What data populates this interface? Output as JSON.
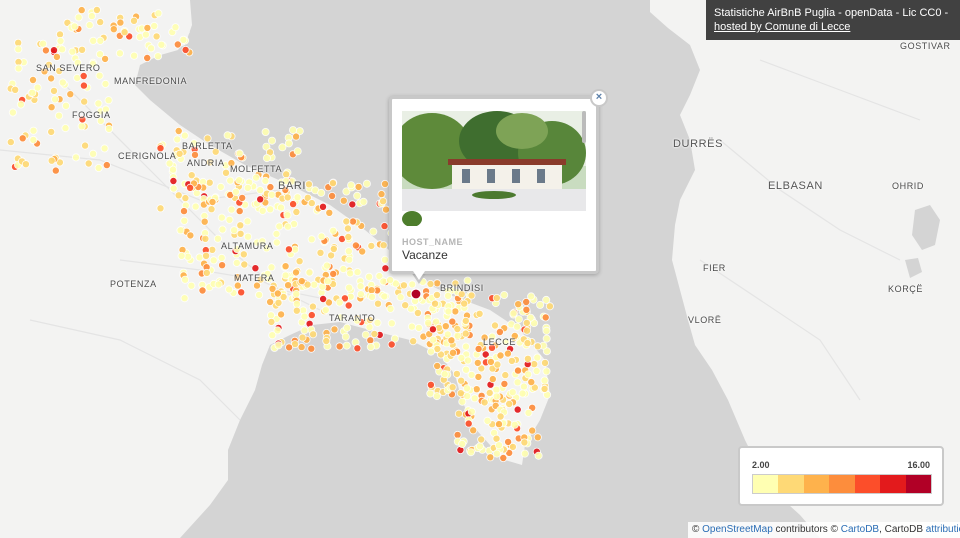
{
  "title_box": {
    "line1": "Statistiche AirBnB Puglia - openData - Lic CC0 -",
    "link": "hosted by Comune di Lecce"
  },
  "cities": [
    {
      "name": "SAN SEVERO"
    },
    {
      "name": "MANFREDONIA"
    },
    {
      "name": "FOGGIA"
    },
    {
      "name": "BARLETTA"
    },
    {
      "name": "CERIGNOLA"
    },
    {
      "name": "ANDRIA"
    },
    {
      "name": "MOLFETTA"
    },
    {
      "name": "BARI"
    },
    {
      "name": "ALTAMURA"
    },
    {
      "name": "MATERA"
    },
    {
      "name": "POTENZA"
    },
    {
      "name": "TARANTO"
    },
    {
      "name": "BRINDISI"
    },
    {
      "name": "LECCE"
    },
    {
      "name": "DURRËS"
    },
    {
      "name": "ELBASAN"
    },
    {
      "name": "OHRID"
    },
    {
      "name": "FIER"
    },
    {
      "name": "VLORË"
    },
    {
      "name": "KORÇË"
    },
    {
      "name": "GOSTIVAR"
    }
  ],
  "popup": {
    "field_label": "HOST_NAME",
    "field_value": "Vacanze",
    "close_icon": "×"
  },
  "legend": {
    "min": "2.00",
    "max": "16.00",
    "colors": [
      "#ffffb2",
      "#fed976",
      "#feb24c",
      "#fd8d3c",
      "#fc4e2a",
      "#e31a1c",
      "#b10026"
    ]
  },
  "attribution": {
    "prefix": "©",
    "osm": "OpenStreetMap",
    "contributors": "contributors ©",
    "cartodb": "CartoDB",
    "middle": ", CartoDB",
    "attr": "attribution"
  },
  "colors": {
    "sea": "#d4d4d4",
    "land": "#f3f3f2",
    "dot_stroke": "#ffffff"
  }
}
